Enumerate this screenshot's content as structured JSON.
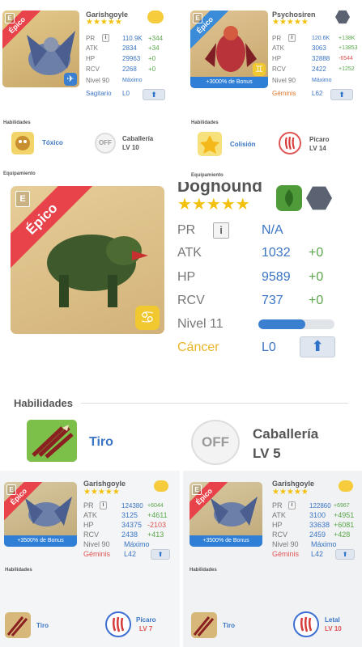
{
  "labels": {
    "pr": "PR",
    "atk": "ATK",
    "hp": "HP",
    "rcv": "RCV",
    "info": "i",
    "habilidades": "Habilidades",
    "equipamiento": "Equipamiento",
    "rarity": "Épico",
    "e_badge": "E",
    "off": "OFF",
    "max": "Máximo"
  },
  "card1": {
    "name": "Garishgoyle",
    "stars": "★★★★★",
    "pr": "110.9K",
    "pr_delta": "+344",
    "atk": "2834",
    "atk_delta": "+34",
    "hp": "29963",
    "hp_delta": "+0",
    "rcv": "2268",
    "rcv_delta": "+0",
    "level": "Nivel 90",
    "level_state": "Máximo",
    "sign": "Sagitario",
    "slot_level": "L0",
    "ability1": "Tóxico",
    "ability2_name": "Caballería",
    "ability2_level": "LV 10"
  },
  "card2": {
    "name": "Psychosiren",
    "stars": "★★★★★",
    "pr": "120.6K",
    "pr_delta": "+138K",
    "atk": "3063",
    "atk_delta": "+13853",
    "hp": "32888",
    "hp_delta": "-6544",
    "rcv": "2422",
    "rcv_delta": "+1252",
    "level": "Nivel 90",
    "level_state": "Máximo",
    "sign": "Géminis",
    "slot_level": "L62",
    "bonus": "+3000% de Bonus",
    "ability1": "Colisión",
    "ability2_name": "Pícaro",
    "ability2_level": "LV 14"
  },
  "card3": {
    "name": "Doghound",
    "stars": "★★★★★",
    "pr": "N/A",
    "atk": "1032",
    "atk_delta": "+0",
    "hp": "9589",
    "hp_delta": "+0",
    "rcv": "737",
    "rcv_delta": "+0",
    "level": "Nivel 11",
    "level_progress": 0.62,
    "sign": "Cáncer",
    "slot_level": "L0",
    "ability1": "Tiro",
    "ability2_name": "Caballería",
    "ability2_level": "LV 5"
  },
  "card4": {
    "name": "Garishgoyle",
    "stars": "★★★★★",
    "pr": "124380",
    "pr_delta": "+6044",
    "atk": "3125",
    "atk_delta": "+4611",
    "hp": "34375",
    "hp_delta": "-2103",
    "rcv": "2438",
    "rcv_delta": "+413",
    "level": "Nivel 90",
    "level_state": "Máximo",
    "sign": "Géminis",
    "slot_level": "L42",
    "bonus": "+3500% de Bonus",
    "ability1": "Tiro",
    "ability2_name": "Pícaro",
    "ability2_level": "LV 7"
  },
  "card5": {
    "name": "Garishgoyle",
    "stars": "★★★★★",
    "pr": "122860",
    "pr_delta": "+6967",
    "atk": "3100",
    "atk_delta": "+4951",
    "hp": "33638",
    "hp_delta": "+6081",
    "rcv": "2459",
    "rcv_delta": "+428",
    "level": "Nivel 90",
    "level_state": "Máximo",
    "sign": "Géminis",
    "slot_level": "L42",
    "bonus": "+3500% de Bonus",
    "ability1": "Tiro",
    "ability2_name": "Letal",
    "ability2_level": "LV 10"
  },
  "colors": {
    "accent": "#3b75c4",
    "plus": "#5aa64a",
    "minus": "#e05454",
    "star": "#f3c10d",
    "ribbon": "#e8424a"
  }
}
